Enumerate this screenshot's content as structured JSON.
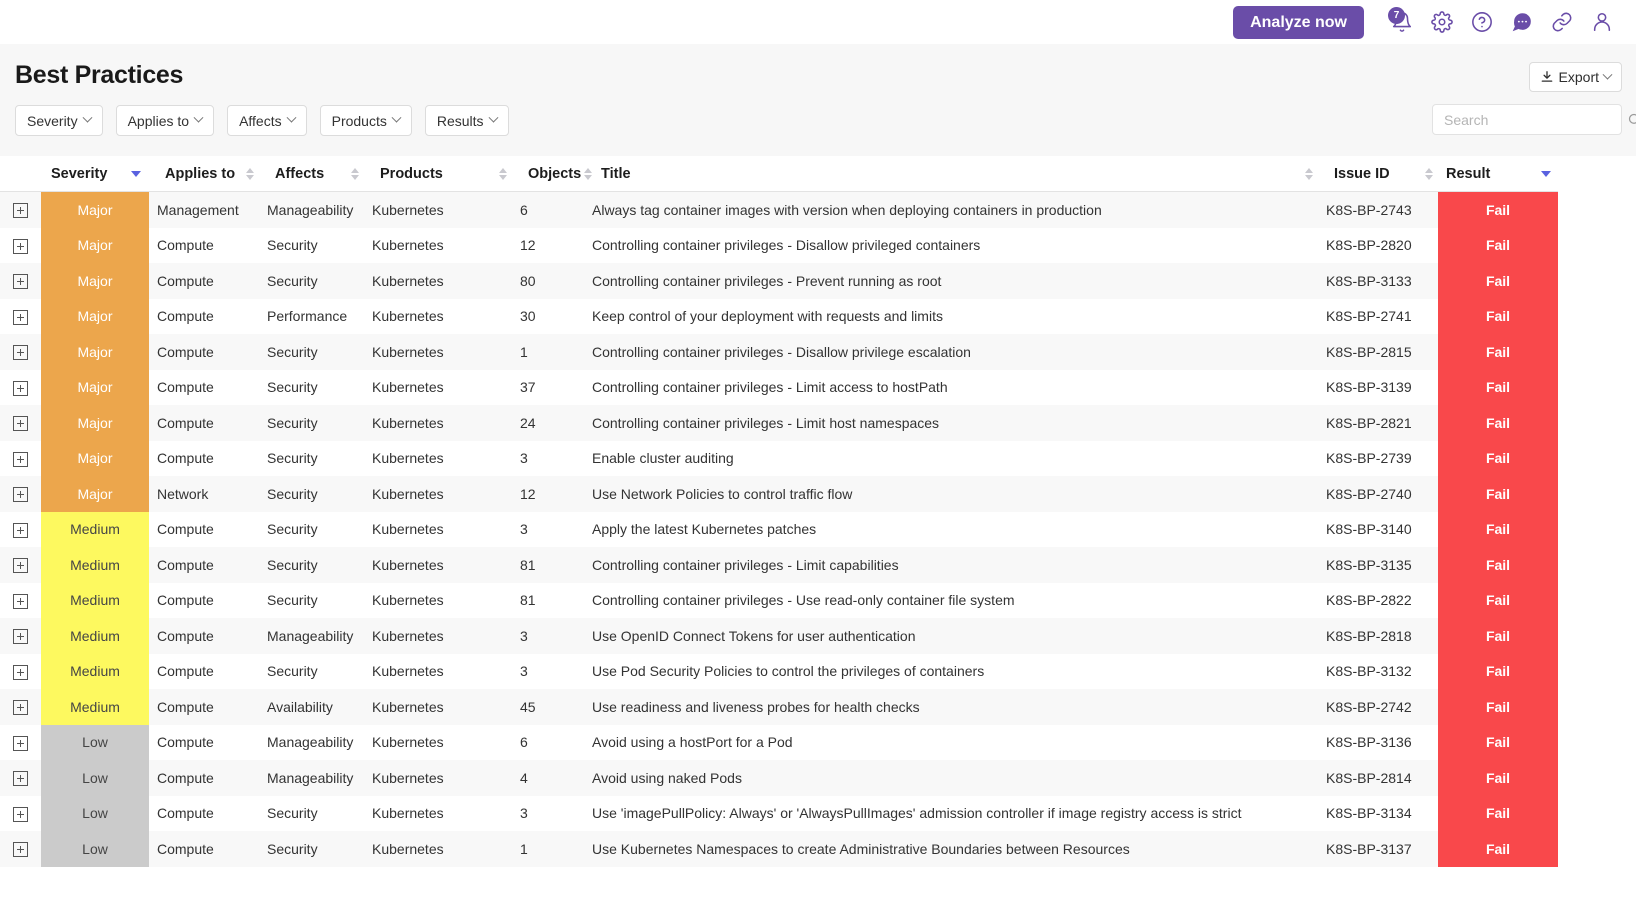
{
  "topbar": {
    "analyze_label": "Analyze now",
    "notification_count": "7",
    "icons": [
      {
        "name": "bell-icon",
        "label": "Notifications"
      },
      {
        "name": "gear-icon",
        "label": "Settings"
      },
      {
        "name": "help-icon",
        "label": "Help"
      },
      {
        "name": "chat-icon",
        "label": "Chat"
      },
      {
        "name": "link-icon",
        "label": "Links"
      },
      {
        "name": "user-icon",
        "label": "Account"
      }
    ],
    "accent_color": "#6a4da8"
  },
  "header": {
    "title": "Best Practices",
    "export_label": "Export",
    "export_icon": "download-icon"
  },
  "filters": [
    {
      "label": "Severity"
    },
    {
      "label": "Applies to"
    },
    {
      "label": "Affects"
    },
    {
      "label": "Products"
    },
    {
      "label": "Results"
    }
  ],
  "search": {
    "placeholder": "Search",
    "value": "",
    "icon": "search-icon"
  },
  "table": {
    "columns": [
      {
        "key": "expand",
        "label": ""
      },
      {
        "key": "severity",
        "label": "Severity",
        "sort": "desc"
      },
      {
        "key": "applies",
        "label": "Applies to",
        "sort": "none"
      },
      {
        "key": "affects",
        "label": "Affects",
        "sort": "none"
      },
      {
        "key": "products",
        "label": "Products",
        "sort": "none"
      },
      {
        "key": "objects",
        "label": "Objects",
        "sort": "none"
      },
      {
        "key": "title",
        "label": "Title",
        "sort": "none"
      },
      {
        "key": "issue",
        "label": "Issue ID",
        "sort": "none"
      },
      {
        "key": "result",
        "label": "Result",
        "sort": "desc"
      }
    ],
    "severity_colors": {
      "Major": "#eca64c",
      "Medium": "#fdf95f",
      "Low": "#cbcbcb"
    },
    "result_color": "#f9484b",
    "rows": [
      {
        "severity": "Major",
        "applies": "Management",
        "affects": "Manageability",
        "products": "Kubernetes",
        "objects": "6",
        "title": "Always tag container images with version when deploying containers in production",
        "issue": "K8S-BP-2743",
        "result": "Fail"
      },
      {
        "severity": "Major",
        "applies": "Compute",
        "affects": "Security",
        "products": "Kubernetes",
        "objects": "12",
        "title": "Controlling container privileges - Disallow privileged containers",
        "issue": "K8S-BP-2820",
        "result": "Fail"
      },
      {
        "severity": "Major",
        "applies": "Compute",
        "affects": "Security",
        "products": "Kubernetes",
        "objects": "80",
        "title": "Controlling container privileges - Prevent running as root",
        "issue": "K8S-BP-3133",
        "result": "Fail"
      },
      {
        "severity": "Major",
        "applies": "Compute",
        "affects": "Performance",
        "products": "Kubernetes",
        "objects": "30",
        "title": "Keep control of your deployment with requests and limits",
        "issue": "K8S-BP-2741",
        "result": "Fail"
      },
      {
        "severity": "Major",
        "applies": "Compute",
        "affects": "Security",
        "products": "Kubernetes",
        "objects": "1",
        "title": "Controlling container privileges - Disallow privilege escalation",
        "issue": "K8S-BP-2815",
        "result": "Fail"
      },
      {
        "severity": "Major",
        "applies": "Compute",
        "affects": "Security",
        "products": "Kubernetes",
        "objects": "37",
        "title": "Controlling container privileges - Limit access to hostPath",
        "issue": "K8S-BP-3139",
        "result": "Fail"
      },
      {
        "severity": "Major",
        "applies": "Compute",
        "affects": "Security",
        "products": "Kubernetes",
        "objects": "24",
        "title": "Controlling container privileges - Limit host namespaces",
        "issue": "K8S-BP-2821",
        "result": "Fail"
      },
      {
        "severity": "Major",
        "applies": "Compute",
        "affects": "Security",
        "products": "Kubernetes",
        "objects": "3",
        "title": "Enable cluster auditing",
        "issue": "K8S-BP-2739",
        "result": "Fail"
      },
      {
        "severity": "Major",
        "applies": "Network",
        "affects": "Security",
        "products": "Kubernetes",
        "objects": "12",
        "title": "Use Network Policies to control traffic flow",
        "issue": "K8S-BP-2740",
        "result": "Fail"
      },
      {
        "severity": "Medium",
        "applies": "Compute",
        "affects": "Security",
        "products": "Kubernetes",
        "objects": "3",
        "title": "Apply the latest Kubernetes patches",
        "issue": "K8S-BP-3140",
        "result": "Fail"
      },
      {
        "severity": "Medium",
        "applies": "Compute",
        "affects": "Security",
        "products": "Kubernetes",
        "objects": "81",
        "title": "Controlling container privileges - Limit capabilities",
        "issue": "K8S-BP-3135",
        "result": "Fail"
      },
      {
        "severity": "Medium",
        "applies": "Compute",
        "affects": "Security",
        "products": "Kubernetes",
        "objects": "81",
        "title": "Controlling container privileges - Use read-only container file system",
        "issue": "K8S-BP-2822",
        "result": "Fail"
      },
      {
        "severity": "Medium",
        "applies": "Compute",
        "affects": "Manageability",
        "products": "Kubernetes",
        "objects": "3",
        "title": "Use OpenID Connect Tokens for user authentication",
        "issue": "K8S-BP-2818",
        "result": "Fail"
      },
      {
        "severity": "Medium",
        "applies": "Compute",
        "affects": "Security",
        "products": "Kubernetes",
        "objects": "3",
        "title": "Use Pod Security Policies to control the privileges of containers",
        "issue": "K8S-BP-3132",
        "result": "Fail"
      },
      {
        "severity": "Medium",
        "applies": "Compute",
        "affects": "Availability",
        "products": "Kubernetes",
        "objects": "45",
        "title": "Use readiness and liveness probes for health checks",
        "issue": "K8S-BP-2742",
        "result": "Fail"
      },
      {
        "severity": "Low",
        "applies": "Compute",
        "affects": "Manageability",
        "products": "Kubernetes",
        "objects": "6",
        "title": "Avoid using a hostPort for a Pod",
        "issue": "K8S-BP-3136",
        "result": "Fail"
      },
      {
        "severity": "Low",
        "applies": "Compute",
        "affects": "Manageability",
        "products": "Kubernetes",
        "objects": "4",
        "title": "Avoid using naked Pods",
        "issue": "K8S-BP-2814",
        "result": "Fail"
      },
      {
        "severity": "Low",
        "applies": "Compute",
        "affects": "Security",
        "products": "Kubernetes",
        "objects": "3",
        "title": "Use 'imagePullPolicy: Always' or 'AlwaysPullImages' admission controller if image registry access is strict",
        "issue": "K8S-BP-3134",
        "result": "Fail"
      },
      {
        "severity": "Low",
        "applies": "Compute",
        "affects": "Security",
        "products": "Kubernetes",
        "objects": "1",
        "title": "Use Kubernetes Namespaces to create Administrative Boundaries between Resources",
        "issue": "K8S-BP-3137",
        "result": "Fail"
      }
    ]
  }
}
